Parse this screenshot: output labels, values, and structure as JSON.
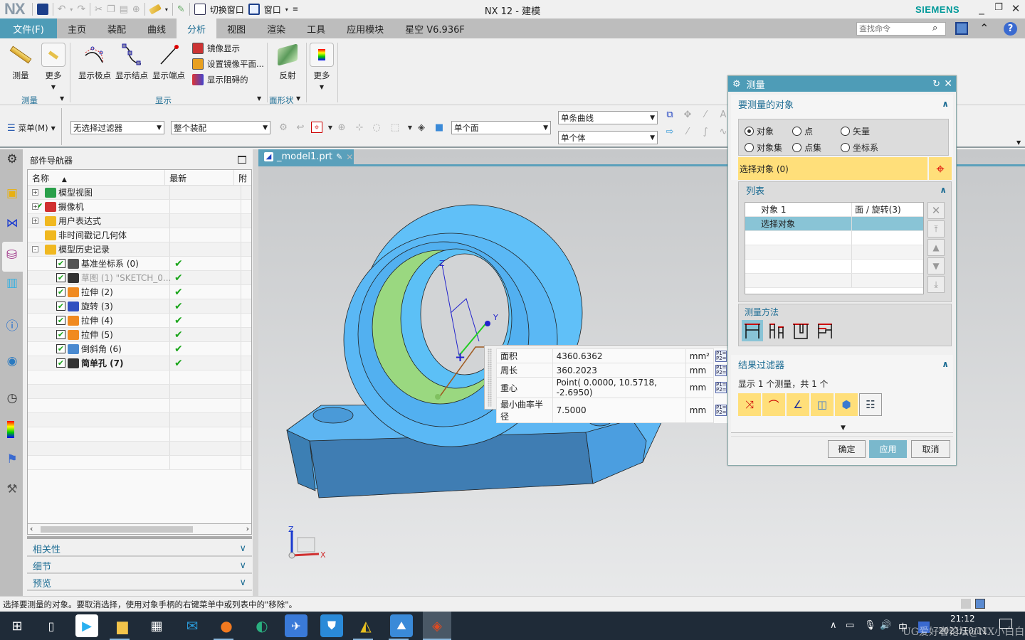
{
  "window": {
    "logo": "NX",
    "title": "NX 12 - 建模",
    "brand": "SIEMENS",
    "controls": [
      "_",
      "❐",
      "✕"
    ],
    "quick_access": {
      "switch_window": "切换窗口",
      "window": "窗口"
    }
  },
  "menu": {
    "file": "文件(F)",
    "tabs": [
      "主页",
      "装配",
      "曲线",
      "分析",
      "视图",
      "渲染",
      "工具",
      "应用模块",
      "星空 V6.936F"
    ],
    "active_tab": "分析",
    "search_placeholder": "查找命令"
  },
  "ribbon": {
    "buttons": {
      "measure": "测量",
      "more1": "更多",
      "show_poles": "显示极点",
      "show_knots": "显示结点",
      "show_endpoints": "显示端点",
      "mirror_display": "镜像显示",
      "set_mirror_plane": "设置镜像平面...",
      "show_blocked": "显示阻碍的",
      "reflection": "反射",
      "more2": "更多"
    },
    "groups": {
      "measure": "测量",
      "display": "显示",
      "face_shape": "面形状"
    }
  },
  "selection_bar": {
    "menu": "菜单(M)",
    "type_filter": "无选择过滤器",
    "scope": "整个装配",
    "face_rule": "单个面",
    "curve_rule": "单条曲线",
    "body_rule": "单个体"
  },
  "navigator": {
    "title": "部件导航器",
    "columns": [
      "名称",
      "最新",
      "附"
    ],
    "rows": [
      {
        "label": "模型视图",
        "level": 0,
        "expander": "+",
        "icon": "model-views-icon",
        "color": "#2aa04a",
        "latest": false,
        "greyed": false,
        "bold": false
      },
      {
        "label": "摄像机",
        "level": 0,
        "expander": "+",
        "icon": "camera-icon",
        "color": "#d03030",
        "latest": false,
        "greyed": false,
        "bold": false,
        "prefix_check": true
      },
      {
        "label": "用户表达式",
        "level": 0,
        "expander": "+",
        "icon": "folder-icon",
        "color": "#f0b820",
        "latest": false,
        "greyed": false,
        "bold": false
      },
      {
        "label": "非时间戳记几何体",
        "level": 0,
        "expander": "",
        "icon": "folder-icon",
        "color": "#f0b820",
        "latest": false,
        "greyed": false,
        "bold": false
      },
      {
        "label": "模型历史记录",
        "level": 0,
        "expander": "-",
        "icon": "folder-icon",
        "color": "#f0b820",
        "latest": false,
        "greyed": false,
        "bold": false
      },
      {
        "label": "基准坐标系 (0)",
        "level": 1,
        "icon": "datum-csys-icon",
        "color": "#555",
        "latest": true,
        "greyed": false,
        "bold": false,
        "checked": true
      },
      {
        "label": "草图 (1) \"SKETCH_0...",
        "level": 1,
        "icon": "sketch-icon",
        "color": "#333",
        "latest": true,
        "greyed": true,
        "bold": false,
        "checked": true
      },
      {
        "label": "拉伸 (2)",
        "level": 1,
        "icon": "extrude-icon",
        "color": "#f08a20",
        "latest": true,
        "greyed": false,
        "bold": false,
        "checked": true
      },
      {
        "label": "旋转 (3)",
        "level": 1,
        "icon": "revolve-icon",
        "color": "#3050c0",
        "latest": true,
        "greyed": false,
        "bold": false,
        "checked": true
      },
      {
        "label": "拉伸 (4)",
        "level": 1,
        "icon": "extrude-icon",
        "color": "#f08a20",
        "latest": true,
        "greyed": false,
        "bold": false,
        "checked": true
      },
      {
        "label": "拉伸 (5)",
        "level": 1,
        "icon": "extrude-icon",
        "color": "#f08a20",
        "latest": true,
        "greyed": false,
        "bold": false,
        "checked": true
      },
      {
        "label": "倒斜角 (6)",
        "level": 1,
        "icon": "chamfer-icon",
        "color": "#4a8ad0",
        "latest": true,
        "greyed": false,
        "bold": false,
        "checked": true
      },
      {
        "label": "简单孔 (7)",
        "level": 1,
        "icon": "hole-icon",
        "color": "#333",
        "latest": true,
        "greyed": false,
        "bold": true,
        "checked": true
      }
    ],
    "panels": [
      "相关性",
      "细节",
      "预览"
    ]
  },
  "document_tab": "_model1.prt",
  "measure_result": {
    "rows": [
      {
        "label": "面积",
        "value": "4360.6362",
        "unit": "mm²"
      },
      {
        "label": "周长",
        "value": "360.2023",
        "unit": "mm"
      },
      {
        "label": "重心",
        "value": "Point( 0.0000, 10.5718, -2.6950)",
        "unit": "mm"
      },
      {
        "label": "最小曲率半径",
        "value": "7.5000",
        "unit": "mm"
      }
    ]
  },
  "csys_labels": {
    "x": "X",
    "y": "Y",
    "z": "Z"
  },
  "dialog": {
    "title": "测量",
    "objects_section": "要测量的对象",
    "radios": [
      {
        "label": "对象",
        "selected": true
      },
      {
        "label": "点",
        "selected": false
      },
      {
        "label": "矢量",
        "selected": false
      },
      {
        "label": "对象集",
        "selected": false
      },
      {
        "label": "点集",
        "selected": false
      },
      {
        "label": "坐标系",
        "selected": false
      }
    ],
    "select_object": "选择对象 (0)",
    "list_section": "列表",
    "list_rows": [
      {
        "name": "对象 1",
        "type": "面 / 旋转(3)",
        "selected": false
      },
      {
        "name": "选择对象",
        "type": "",
        "selected": true
      }
    ],
    "method_section": "测量方法",
    "results_filter_section": "结果过滤器",
    "results_summary": "显示 1 个测量，共 1 个",
    "ok": "确定",
    "apply": "应用",
    "cancel": "取消"
  },
  "status": "选择要测量的对象。要取消选择，使用对象手柄的右键菜单中或列表中的\"移除\"。",
  "taskbar": {
    "time": "21:12",
    "date": "2021/10/11",
    "ime": "中",
    "watermark": "UG爱好者论坛@NX小白白"
  }
}
